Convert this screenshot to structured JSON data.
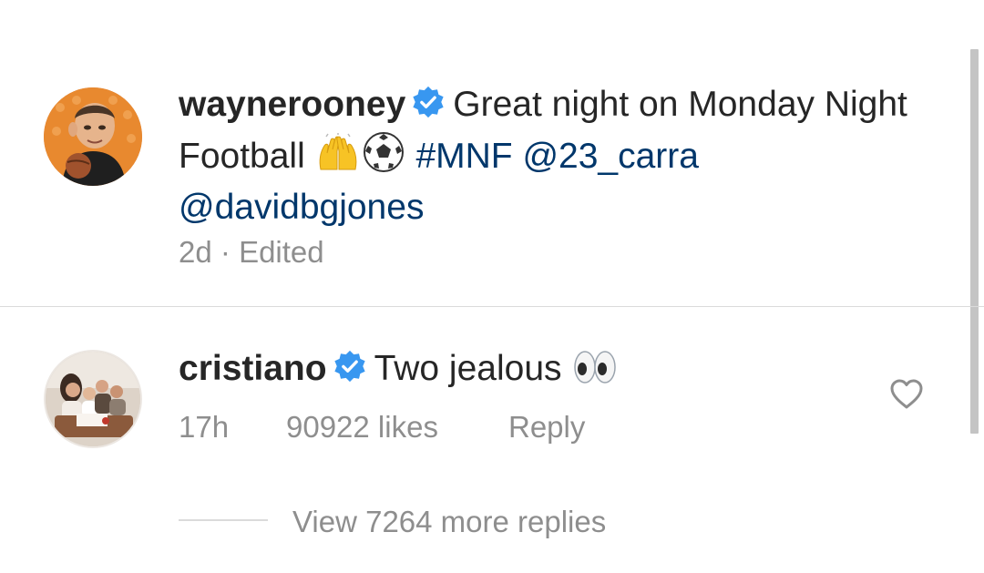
{
  "post": {
    "username": "waynerooney",
    "caption_text": "Great night on Monday Night Football",
    "hashtag": "#MNF",
    "mention_1": "@23_carra",
    "mention_2": "@davidbgjones",
    "time": "2d",
    "separator": "·",
    "edited": "Edited",
    "emoji": [
      "raising-hands",
      "soccer-ball"
    ]
  },
  "comment": {
    "username": "cristiano",
    "text": "Two jealous",
    "emoji": "eyes",
    "time": "17h",
    "likes": "90922 likes",
    "reply_label": "Reply"
  },
  "replies": {
    "label": "View 7264 more replies"
  },
  "colors": {
    "text": "#262626",
    "secondary": "#8e8e8e",
    "link": "#00376b",
    "verified": "#3897f0",
    "divider": "#dbdbdb"
  }
}
